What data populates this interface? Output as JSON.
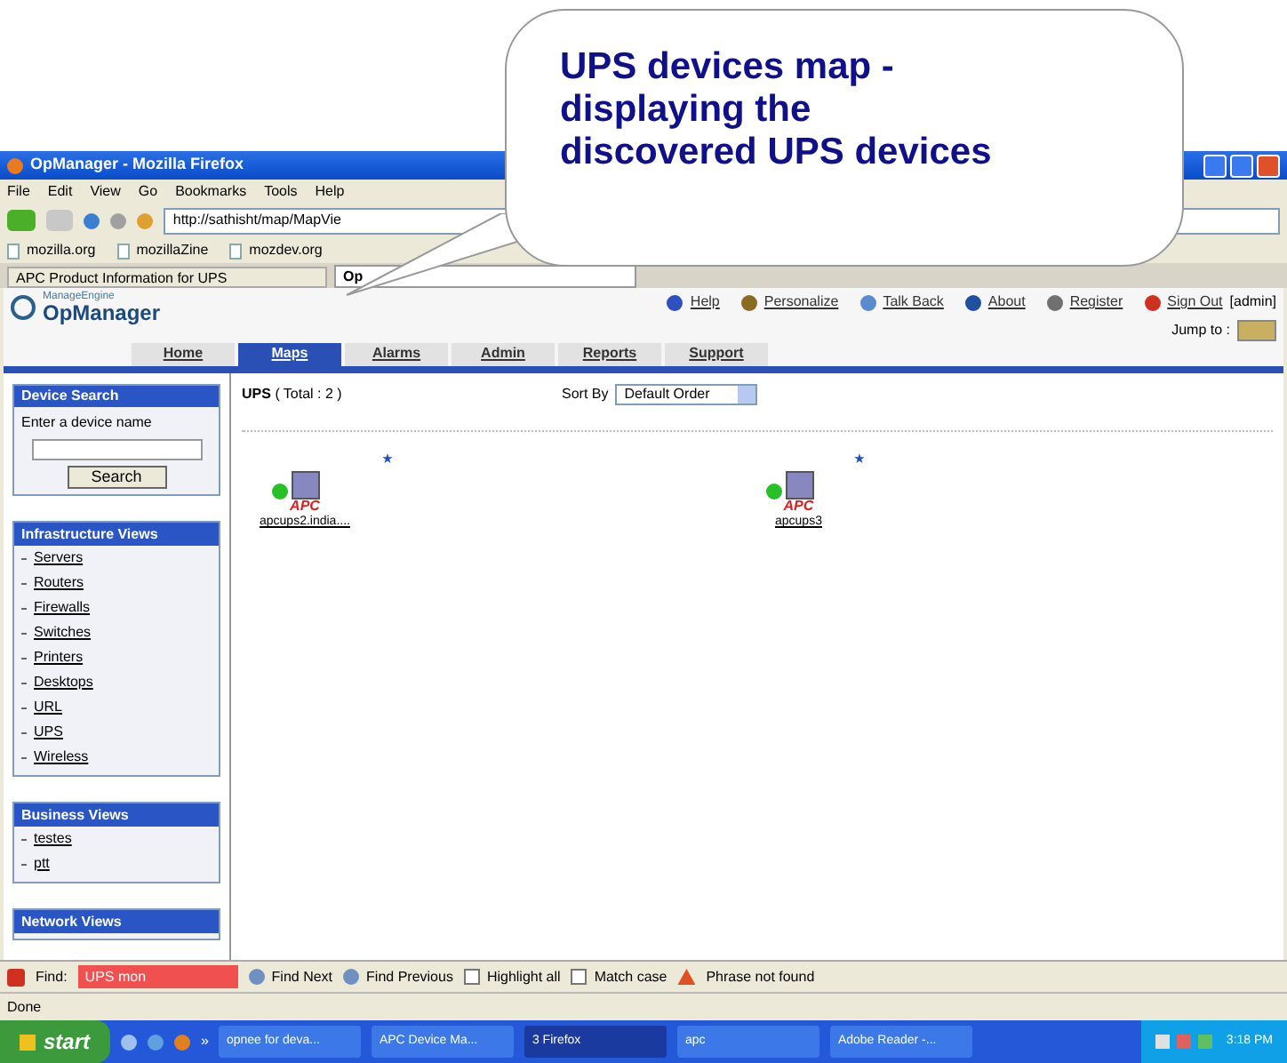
{
  "callout": {
    "lines": [
      "UPS devices map -",
      "displaying the",
      "discovered UPS devices"
    ]
  },
  "window": {
    "title": "OpManager - Mozilla Firefox"
  },
  "menu": [
    "File",
    "Edit",
    "View",
    "Go",
    "Bookmarks",
    "Tools",
    "Help"
  ],
  "address": {
    "value": "http://sathisht/map/MapVie"
  },
  "bookmarks": [
    "mozilla.org",
    "mozillaZine",
    "mozdev.org"
  ],
  "browser_tabs": [
    {
      "label": "APC Product Information for UPS",
      "selected": false
    },
    {
      "label": "Op",
      "selected": true
    }
  ],
  "header": {
    "brand_small": "ManageEngine",
    "brand": "OpManager",
    "links": [
      {
        "label": "Help",
        "kind": "help"
      },
      {
        "label": "Personalize",
        "kind": "personalize"
      },
      {
        "label": "Talk Back",
        "kind": "talkback"
      },
      {
        "label": "About",
        "kind": "about"
      },
      {
        "label": "Register",
        "kind": "register"
      },
      {
        "label": "Sign Out",
        "kind": "signout"
      }
    ],
    "user": "[admin]",
    "jump_to": "Jump to :"
  },
  "nav_tabs": [
    {
      "label": "Home",
      "selected": false
    },
    {
      "label": "Maps",
      "selected": true
    },
    {
      "label": "Alarms",
      "selected": false
    },
    {
      "label": "Admin",
      "selected": false
    },
    {
      "label": "Reports",
      "selected": false
    },
    {
      "label": "Support",
      "selected": false
    }
  ],
  "sidebar": {
    "device_search": {
      "title": "Device Search",
      "label": "Enter a device name",
      "button": "Search"
    },
    "sections": [
      {
        "title": "Infrastructure Views",
        "items": [
          "Servers",
          "Routers",
          "Firewalls",
          "Switches",
          "Printers",
          "Desktops",
          "URL",
          "UPS",
          "Wireless"
        ]
      },
      {
        "title": "Business Views",
        "items": [
          "testes",
          "ptt"
        ]
      },
      {
        "title": "Network Views"
      }
    ]
  },
  "main": {
    "title": "UPS",
    "total": "( Total : 2 )",
    "sort_label": "Sort By",
    "sort_value": "Default Order",
    "devices": [
      {
        "name": "apcups2.india....",
        "vendor": "APC",
        "online": true
      },
      {
        "name": "apcups3",
        "vendor": "APC",
        "online": true
      }
    ]
  },
  "find_bar": {
    "label": "Find:",
    "value": "UPS mon",
    "not_found": true,
    "find_next": "Find Next",
    "find_previous": "Find Previous",
    "highlight": {
      "label": "Highlight all",
      "checked": false
    },
    "match_case": {
      "label": "Match case",
      "checked": false
    },
    "message": "Phrase not found"
  },
  "status": "Done",
  "taskbar": {
    "start": "start",
    "overflow": "»",
    "buttons": [
      {
        "label": "opnee for deva...",
        "selected": false
      },
      {
        "label": "APC Device Ma...",
        "selected": false
      },
      {
        "label": "3 Firefox",
        "selected": true
      },
      {
        "label": "apc",
        "selected": false
      },
      {
        "label": "Adobe Reader -...",
        "selected": false
      }
    ],
    "clock": "3:18 PM"
  }
}
